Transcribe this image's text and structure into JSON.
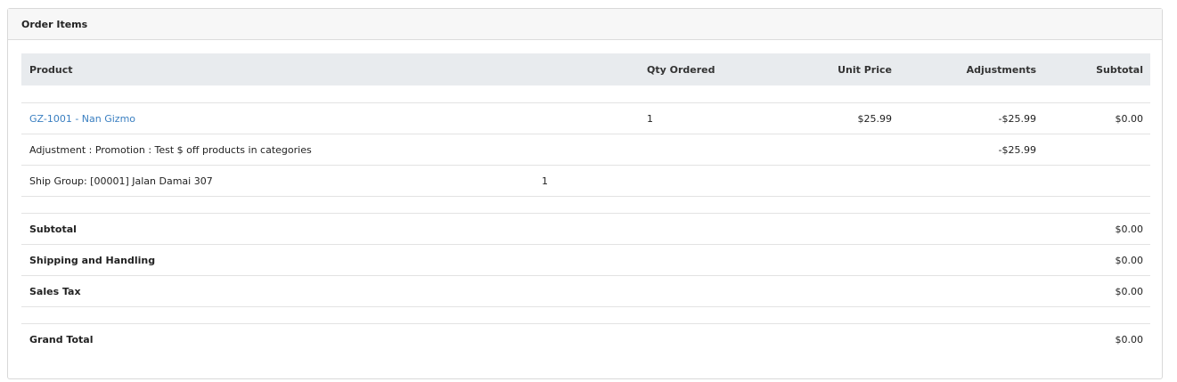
{
  "panel": {
    "title": "Order Items"
  },
  "table": {
    "headers": {
      "product": "Product",
      "qty_ordered": "Qty Ordered",
      "unit_price": "Unit Price",
      "adjustments": "Adjustments",
      "subtotal": "Subtotal"
    },
    "item": {
      "product": "GZ-1001 - Nan Gizmo",
      "qty": "1",
      "unit_price": "$25.99",
      "adjustment": "-$25.99",
      "subtotal": "$0.00"
    },
    "adjustment_row": {
      "label": "Adjustment : Promotion : Test $ off products in categories",
      "amount": "-$25.99"
    },
    "ship_group": {
      "label": "Ship Group: [00001] Jalan Damai 307",
      "qty": "1"
    }
  },
  "totals": {
    "subtotal_label": "Subtotal",
    "subtotal_value": "$0.00",
    "shipping_label": "Shipping and Handling",
    "shipping_value": "$0.00",
    "tax_label": "Sales Tax",
    "tax_value": "$0.00",
    "grand_total_label": "Grand Total",
    "grand_total_value": "$0.00"
  },
  "colors": {
    "link": "#3a7fc1",
    "header_bg": "#e8ebee"
  }
}
